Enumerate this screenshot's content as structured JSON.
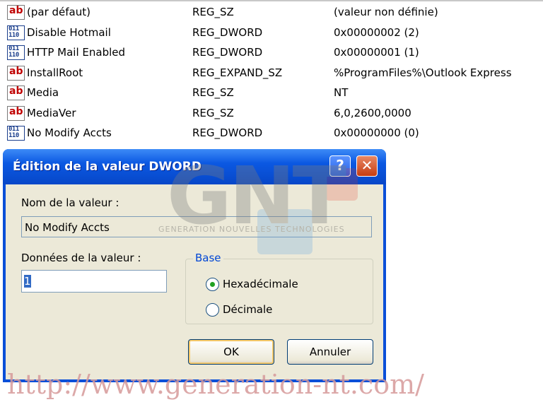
{
  "registry": {
    "rows": [
      {
        "icon": "string-value-icon",
        "icon_text": "ab",
        "name": "(par défaut)",
        "type": "REG_SZ",
        "data": "(valeur non définie)"
      },
      {
        "icon": "binary-value-icon",
        "icon_text": "011\n110",
        "name": "Disable Hotmail",
        "type": "REG_DWORD",
        "data": "0x00000002 (2)"
      },
      {
        "icon": "binary-value-icon",
        "icon_text": "011\n110",
        "name": "HTTP Mail Enabled",
        "type": "REG_DWORD",
        "data": "0x00000001 (1)"
      },
      {
        "icon": "string-value-icon",
        "icon_text": "ab",
        "name": "InstallRoot",
        "type": "REG_EXPAND_SZ",
        "data": "%ProgramFiles%\\Outlook Express"
      },
      {
        "icon": "string-value-icon",
        "icon_text": "ab",
        "name": "Media",
        "type": "REG_SZ",
        "data": "NT"
      },
      {
        "icon": "string-value-icon",
        "icon_text": "ab",
        "name": "MediaVer",
        "type": "REG_SZ",
        "data": "6,0,2600,0000"
      },
      {
        "icon": "binary-value-icon",
        "icon_text": "011\n110",
        "name": "No Modify Accts",
        "type": "REG_DWORD",
        "data": "0x00000000 (0)"
      }
    ]
  },
  "dialog": {
    "title": "Édition de la valeur DWORD",
    "help_label": "?",
    "close_label": "✕",
    "value_name_label": "Nom de la valeur :",
    "value_name": "No Modify Accts",
    "value_data_label": "Données de la valeur :",
    "value_data": "1",
    "base_label": "Base",
    "base_options": [
      {
        "label": "Hexadécimale",
        "selected": true
      },
      {
        "label": "Décimale",
        "selected": false
      }
    ],
    "ok_label": "OK",
    "cancel_label": "Annuler"
  },
  "watermark": {
    "logo_text": "GNT",
    "tagline": "GENERATION NOUVELLES TECHNOLOGIES",
    "url": "http://www.generation-nt.com/"
  },
  "colors": {
    "titlebar": "#0b58e2",
    "dialog_bg": "#ece9d8",
    "base_legend": "#0046d5",
    "string_icon": "#c00000",
    "binary_icon": "#1a3e8c"
  }
}
